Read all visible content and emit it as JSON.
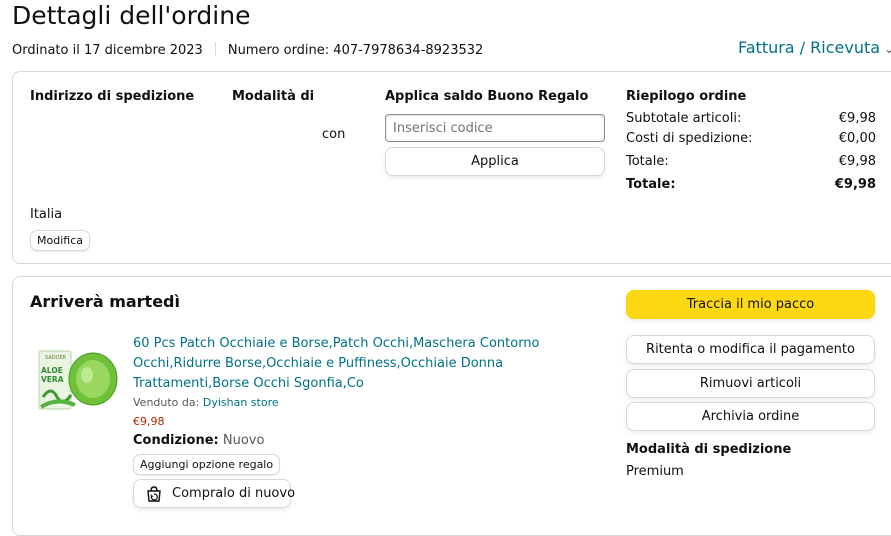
{
  "page": {
    "title": "Dettagli dell'ordine",
    "order_date": "Ordinato il 17 dicembre 2023",
    "order_number": "Numero ordine: 407-7978634-8923532",
    "invoice_link": "Fattura / Ricevuta"
  },
  "shipping": {
    "heading": "Indirizzo di spedizione",
    "country": "Italia",
    "edit_label": "Modifica"
  },
  "payment": {
    "heading": "Modalità di",
    "partial_text": "con"
  },
  "gift_card": {
    "heading": "Applica saldo Buono Regalo",
    "placeholder": "Inserisci codice",
    "apply_label": "Applica"
  },
  "summary": {
    "heading": "Riepilogo ordine",
    "rows": [
      {
        "label": "Subtotale articoli:",
        "value": "€9,98"
      },
      {
        "label": "Costi di spedizione:",
        "value": "€0,00"
      },
      {
        "label": "Totale:",
        "value": "€9,98"
      },
      {
        "label": "Totale:",
        "value": "€9,98"
      }
    ]
  },
  "shipment": {
    "heading": "Arriverà martedì",
    "product": {
      "title": "60 Pcs Patch Occhiaie e Borse,Patch Occhi,Maschera Contorno Occhi,Ridurre Borse,Occhiaie e Puffiness,Occhiaie Donna Trattamenti,Borse Occhi Sgonfia,Co",
      "sold_by_label": "Venduto da:",
      "seller": "Dyishan store",
      "price": "€9,98",
      "condition_label": "Condizione:",
      "condition_value": "Nuovo",
      "gift_option_label": "Aggiungi opzione regalo",
      "buy_again_label": "Compralo di nuovo",
      "image_label": "ALOE VERA",
      "image_brand": "SADOER"
    },
    "actions": {
      "track": "Traccia il mio pacco",
      "retry_payment": "Ritenta o modifica il pagamento",
      "remove_items": "Rimuovi articoli",
      "archive": "Archivia ordine"
    },
    "delivery_method_heading": "Modalità di spedizione",
    "delivery_method_value": "Premium"
  },
  "colors": {
    "link": "#007185",
    "price": "#b12704",
    "primary_button": "#ffd814",
    "border": "#d5d9d9"
  }
}
